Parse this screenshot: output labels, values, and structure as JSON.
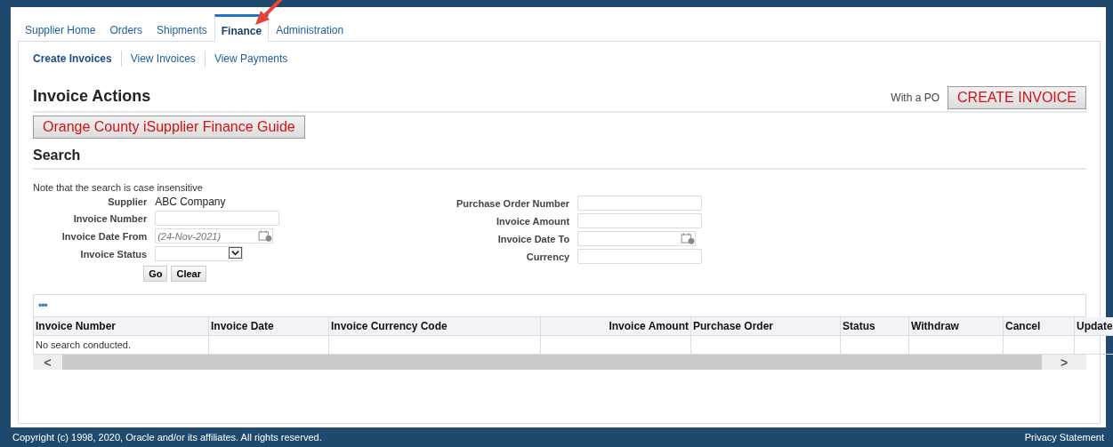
{
  "tabs": [
    {
      "label": "Supplier Home",
      "selected": false
    },
    {
      "label": "Orders",
      "selected": false
    },
    {
      "label": "Shipments",
      "selected": false
    },
    {
      "label": "Finance",
      "selected": true
    },
    {
      "label": "Administration",
      "selected": false
    }
  ],
  "subtabs": [
    {
      "label": "Create Invoices",
      "selected": true
    },
    {
      "label": "View Invoices",
      "selected": false
    },
    {
      "label": "View Payments",
      "selected": false
    }
  ],
  "invoice_actions": {
    "title": "Invoice Actions",
    "po_label": "With a PO",
    "create_button": "CREATE INVOICE",
    "guide_button": "Orange County iSupplier Finance Guide"
  },
  "search": {
    "title": "Search",
    "note": "Note that the search is case insensitive",
    "left_fields": [
      {
        "kind": "static",
        "label": "Supplier",
        "value": "ABC Company"
      },
      {
        "kind": "text",
        "label": "Invoice Number"
      },
      {
        "kind": "date",
        "label": "Invoice Date From",
        "placeholder": "(24-Nov-2021)"
      },
      {
        "kind": "select",
        "label": "Invoice Status"
      }
    ],
    "right_fields": [
      {
        "kind": "text",
        "label": "Purchase Order Number"
      },
      {
        "kind": "text",
        "label": "Invoice Amount"
      },
      {
        "kind": "date",
        "label": "Invoice Date To"
      },
      {
        "kind": "text",
        "label": "Currency"
      }
    ],
    "buttons": [
      "Go",
      "Clear"
    ]
  },
  "table": {
    "menu": "•••",
    "columns": [
      {
        "label": "Invoice Number",
        "kind": "text"
      },
      {
        "label": "Invoice Date",
        "kind": "text"
      },
      {
        "label": "Invoice Currency Code",
        "kind": "text"
      },
      {
        "label": "Invoice Amount",
        "kind": "amount"
      },
      {
        "label": "Purchase Order",
        "kind": "text"
      },
      {
        "label": "Status",
        "kind": "text"
      },
      {
        "label": "Withdraw",
        "kind": "text"
      },
      {
        "label": "Cancel",
        "kind": "text"
      },
      {
        "label": "Update",
        "kind": "text"
      }
    ],
    "empty_message": "No search conducted.",
    "scroll_left": "<",
    "scroll_right": ">"
  },
  "footer": {
    "copyright": "Copyright (c) 1998, 2020, Oracle and/or its affiliates. All rights reserved.",
    "privacy": "Privacy Statement"
  }
}
